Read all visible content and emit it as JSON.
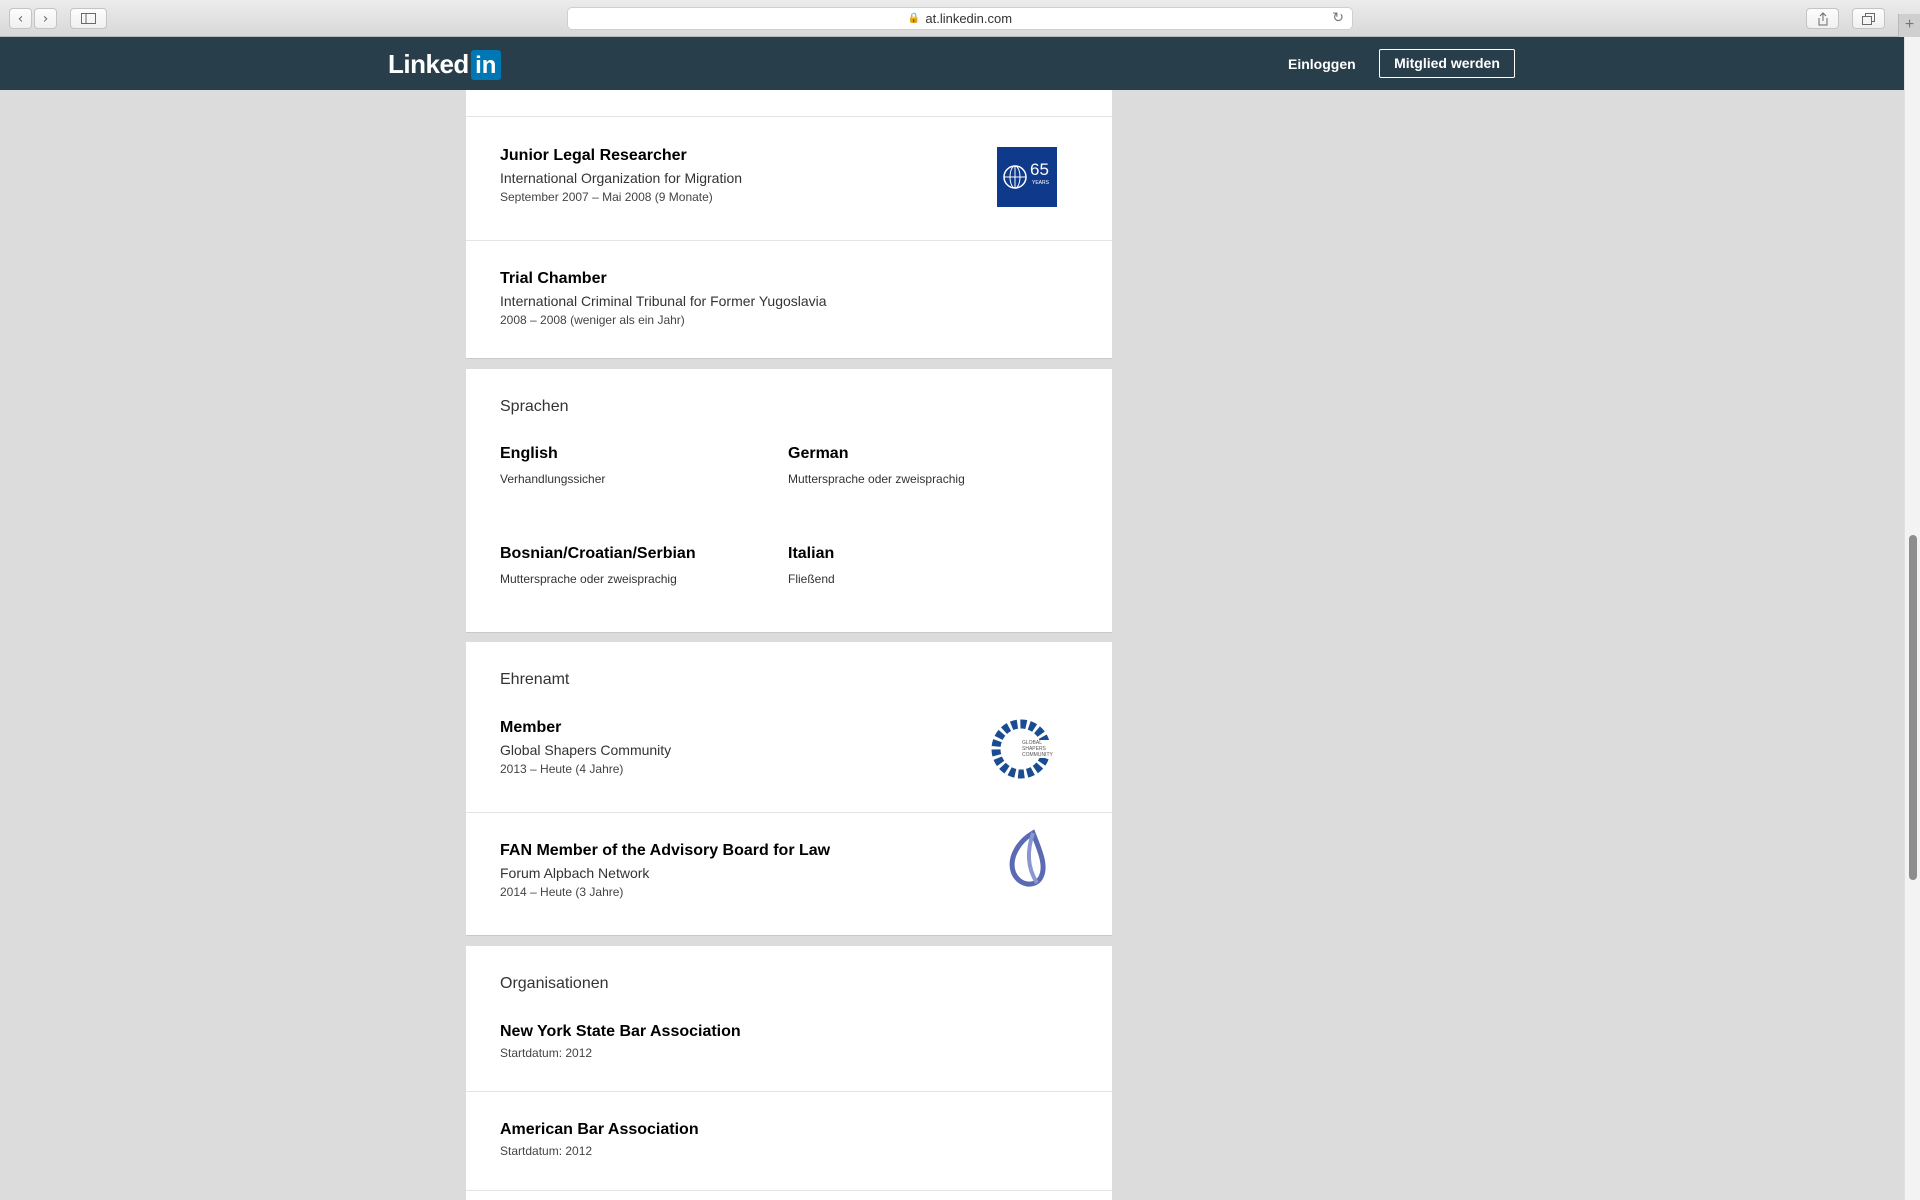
{
  "browser": {
    "url": "at.linkedin.com",
    "back_icon": "chevron-left-icon",
    "forward_icon": "chevron-right-icon"
  },
  "header": {
    "logo_text": "Linked",
    "logo_in": "in",
    "login_label": "Einloggen",
    "join_label": "Mitglied werden"
  },
  "experience": [
    {
      "title": "Junior Legal Researcher",
      "org": "International Organization for Migration",
      "dates": "September 2007 – Mai 2008 (9 Monate)",
      "logo_text": "65",
      "logo_sub": "YEARS"
    },
    {
      "title": "Trial Chamber",
      "org": "International Criminal Tribunal for Former Yugoslavia",
      "dates": "2008 – 2008 (weniger als ein Jahr)"
    }
  ],
  "languages": {
    "title": "Sprachen",
    "items": [
      {
        "name": "English",
        "level": "Verhandlungssicher"
      },
      {
        "name": "German",
        "level": "Muttersprache oder zweisprachig"
      },
      {
        "name": "Bosnian/Croatian/Serbian",
        "level": "Muttersprache oder zweisprachig"
      },
      {
        "name": "Italian",
        "level": "Fließend"
      }
    ]
  },
  "volunteer": {
    "title": "Ehrenamt",
    "items": [
      {
        "title": "Member",
        "org": "Global Shapers Community",
        "dates": "2013 – Heute (4 Jahre)",
        "logo_lines": [
          "GLOBAL",
          "SHAPERS",
          "COMMUNITY"
        ]
      },
      {
        "title": "FAN Member of the Advisory Board for Law",
        "org": "Forum Alpbach Network",
        "dates": "2014 – Heute (3 Jahre)"
      }
    ]
  },
  "organizations": {
    "title": "Organisationen",
    "items": [
      {
        "title": "New York State Bar Association",
        "dates": "Startdatum: 2012"
      },
      {
        "title": "American Bar Association",
        "dates": "Startdatum: 2012"
      }
    ]
  }
}
